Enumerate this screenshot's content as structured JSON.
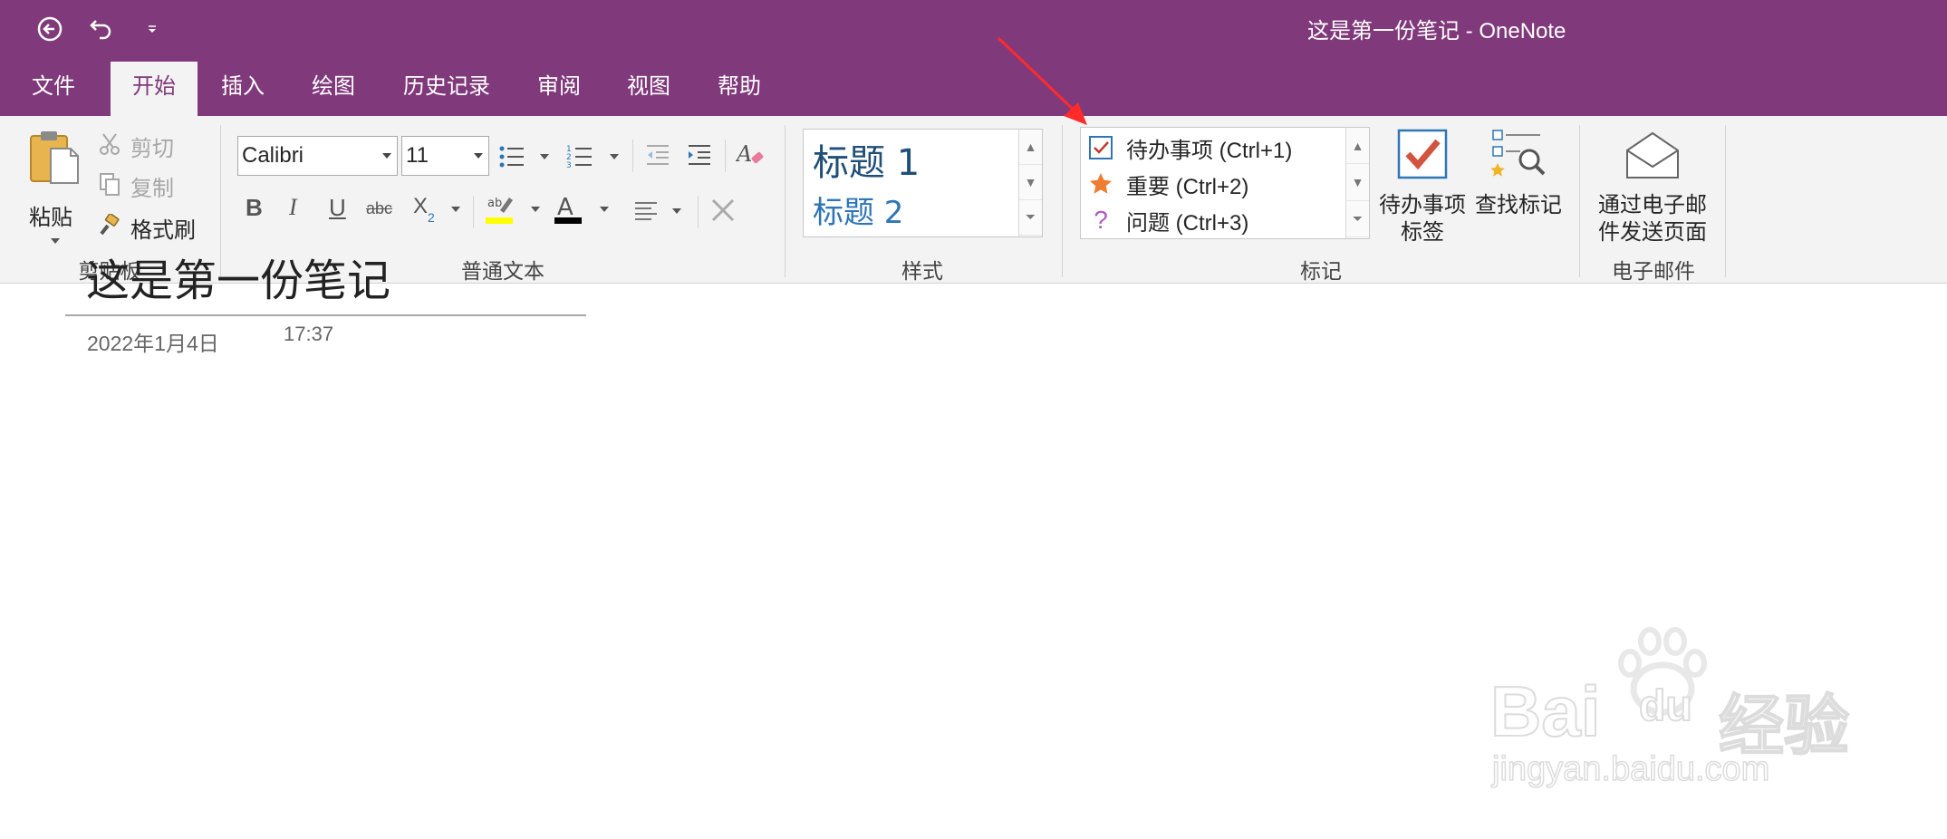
{
  "window": {
    "title": "这是第一份笔记  -  OneNote"
  },
  "tabs": [
    {
      "label": "文件"
    },
    {
      "label": "开始"
    },
    {
      "label": "插入"
    },
    {
      "label": "绘图"
    },
    {
      "label": "历史记录"
    },
    {
      "label": "审阅"
    },
    {
      "label": "视图"
    },
    {
      "label": "帮助"
    }
  ],
  "clipboard": {
    "paste_label": "粘贴",
    "cut_label": "剪切",
    "copy_label": "复制",
    "format_painter_label": "格式刷",
    "group_label": "剪贴板"
  },
  "basic_text": {
    "font_name": "Calibri",
    "font_size": "11",
    "bold": "B",
    "italic": "I",
    "underline": "U",
    "strike": "abc",
    "subscript": "X",
    "group_label": "普通文本"
  },
  "styles": {
    "heading1": "标题 1",
    "heading2": "标题 2",
    "group_label": "样式"
  },
  "tags": {
    "items": [
      {
        "label": "待办事项 (Ctrl+1)"
      },
      {
        "label": "重要 (Ctrl+2)"
      },
      {
        "label": "问题 (Ctrl+3)"
      }
    ],
    "todo_tag_line1": "待办事项",
    "todo_tag_line2": "标签",
    "find_tags": "查找标记",
    "group_label": "标记"
  },
  "email": {
    "line1": "通过电子邮",
    "line2": "件发送页面",
    "group_label": "电子邮件"
  },
  "page": {
    "title": "这是第一份笔记",
    "date": "2022年1月4日",
    "time": "17:37"
  },
  "watermark": {
    "brand": "Bai",
    "brand2": "du",
    "cn": "经验",
    "url": "jingyan.baidu.com"
  },
  "colors": {
    "accent": "#80397b",
    "ribbon": "#f3f3f3",
    "heading_blue": "#2e75b6",
    "highlight_yellow": "#ffff00",
    "annotation_red": "#ff2b2b"
  }
}
